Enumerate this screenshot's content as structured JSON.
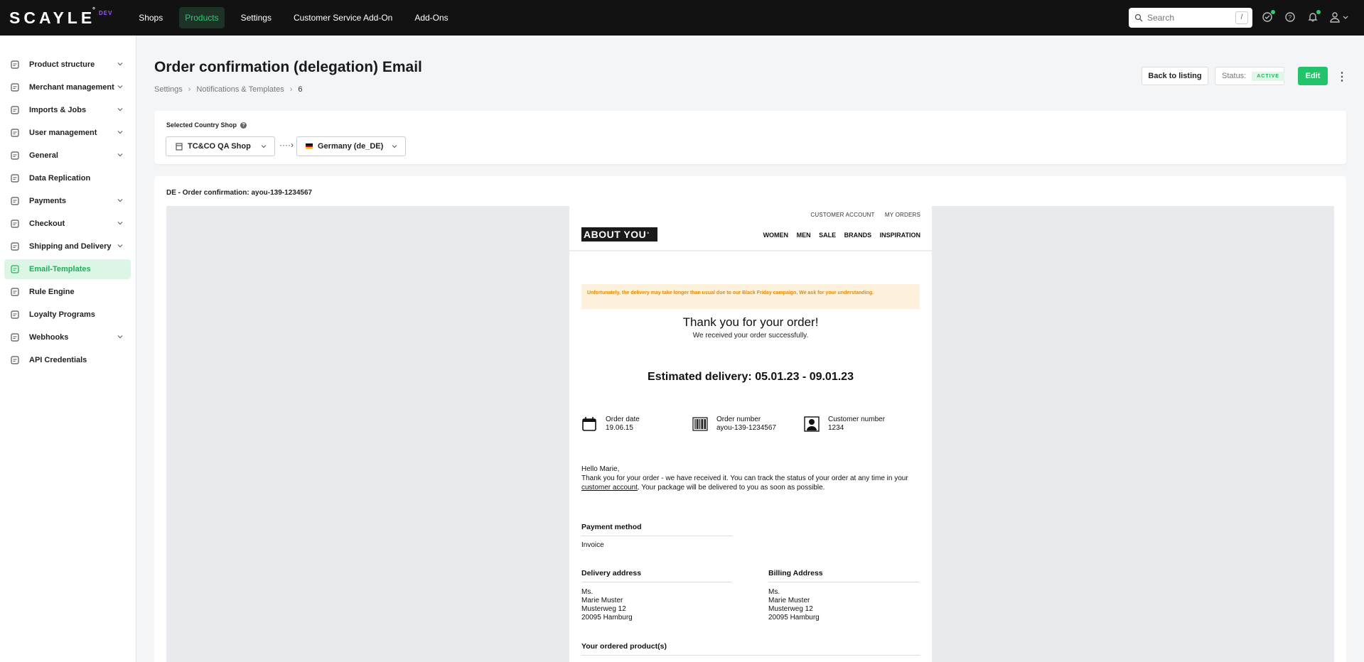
{
  "app": {
    "logo": "SCAYLE",
    "env_badge": "DEV",
    "nav": [
      "Shops",
      "Products",
      "Settings",
      "Customer Service Add-On",
      "Add-Ons"
    ],
    "nav_active": "Products",
    "search": {
      "placeholder": "Search",
      "shortcut": "/"
    },
    "colors": {
      "accent": "#22c36a",
      "topbar": "#121212",
      "env": "#9c58ff"
    }
  },
  "sidebar": {
    "items": [
      {
        "label": "Product structure",
        "icon": "hierarchy-icon",
        "expandable": true
      },
      {
        "label": "Merchant management",
        "icon": "store-icon",
        "expandable": true
      },
      {
        "label": "Imports & Jobs",
        "icon": "import-icon",
        "expandable": true
      },
      {
        "label": "User management",
        "icon": "user-icon",
        "expandable": true
      },
      {
        "label": "General",
        "icon": "gear-icon",
        "expandable": true
      },
      {
        "label": "Data Replication",
        "icon": "replication-icon",
        "expandable": false
      },
      {
        "label": "Payments",
        "icon": "payment-icon",
        "expandable": true
      },
      {
        "label": "Checkout",
        "icon": "cart-icon",
        "expandable": true
      },
      {
        "label": "Shipping and Delivery",
        "icon": "truck-icon",
        "expandable": true
      },
      {
        "label": "Email-Templates",
        "icon": "email-template-icon",
        "expandable": false,
        "active": true
      },
      {
        "label": "Rule Engine",
        "icon": "rule-icon",
        "expandable": false
      },
      {
        "label": "Loyalty Programs",
        "icon": "loyalty-icon",
        "expandable": false
      },
      {
        "label": "Webhooks",
        "icon": "webhook-icon",
        "expandable": true
      },
      {
        "label": "API Credentials",
        "icon": "key-icon",
        "expandable": false
      }
    ]
  },
  "page": {
    "title": "Order confirmation (delegation) Email",
    "breadcrumb": [
      "Settings",
      "Notifications & Templates",
      "6"
    ],
    "back_label": "Back to listing",
    "status_label": "Status:",
    "status_value": "ACTIVE",
    "edit_label": "Edit"
  },
  "country_shop": {
    "label": "Selected Country Shop",
    "shop": "TC&CO QA Shop",
    "country": "Germany (de_DE)"
  },
  "preview": {
    "title": "DE - Order confirmation: ayou-139-1234567",
    "email": {
      "top_links": [
        "CUSTOMER ACCOUNT",
        "MY ORDERS"
      ],
      "logo": "ABOUT YOU",
      "nav": [
        "WOMEN",
        "MEN",
        "SALE",
        "BRANDS",
        "INSPIRATION"
      ],
      "notice": "Unfortunately, the delivery may take longer than usual due to our Black Friday campaign. We ask for your understanding.",
      "thanks": "Thank you for your order!",
      "thanks_sub": "We received your order successfully.",
      "estimated": "Estimated delivery: 05.01.23 - 09.01.23",
      "order_date_label": "Order date",
      "order_date": "19.06.15",
      "order_number_label": "Order number",
      "order_number": "ayou-139-1234567",
      "customer_number_label": "Customer number",
      "customer_number": "1234",
      "greeting": "Hello Marie,",
      "body_1": "Thank you for your order - we have received it. You can track the status of your order at any time in your ",
      "body_link": "customer account",
      "body_2": ". Your package will be delivered to you as soon as possible.",
      "payment_heading": "Payment method",
      "payment_value": "Invoice",
      "delivery_heading": "Delivery address",
      "billing_heading": "Billing Address",
      "address": [
        "Ms.",
        "Marie Muster",
        "Musterweg 12",
        "20095 Hamburg"
      ],
      "products_heading": "Your ordered product(s)"
    }
  }
}
